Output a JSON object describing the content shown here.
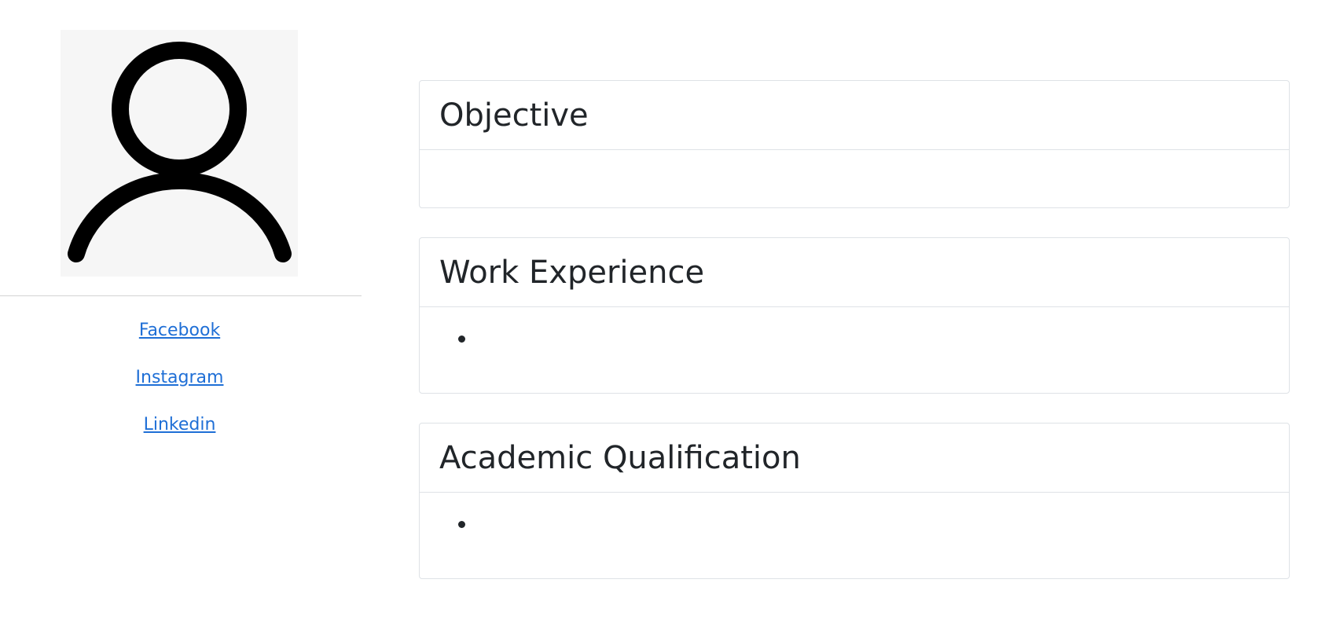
{
  "sidebar": {
    "avatar_icon": "user-icon",
    "links": [
      {
        "label": "Facebook"
      },
      {
        "label": "Instagram"
      },
      {
        "label": "Linkedin"
      }
    ]
  },
  "sections": {
    "objective": {
      "title": "Objective",
      "text": ""
    },
    "work_experience": {
      "title": "Work Experience",
      "items": [
        ""
      ]
    },
    "academic_qualification": {
      "title": "Academic Qualification",
      "items": [
        ""
      ]
    }
  },
  "colors": {
    "link": "#1f6fd6",
    "text": "#212529",
    "border": "#dee2e6",
    "avatar_bg": "#f6f6f6"
  }
}
